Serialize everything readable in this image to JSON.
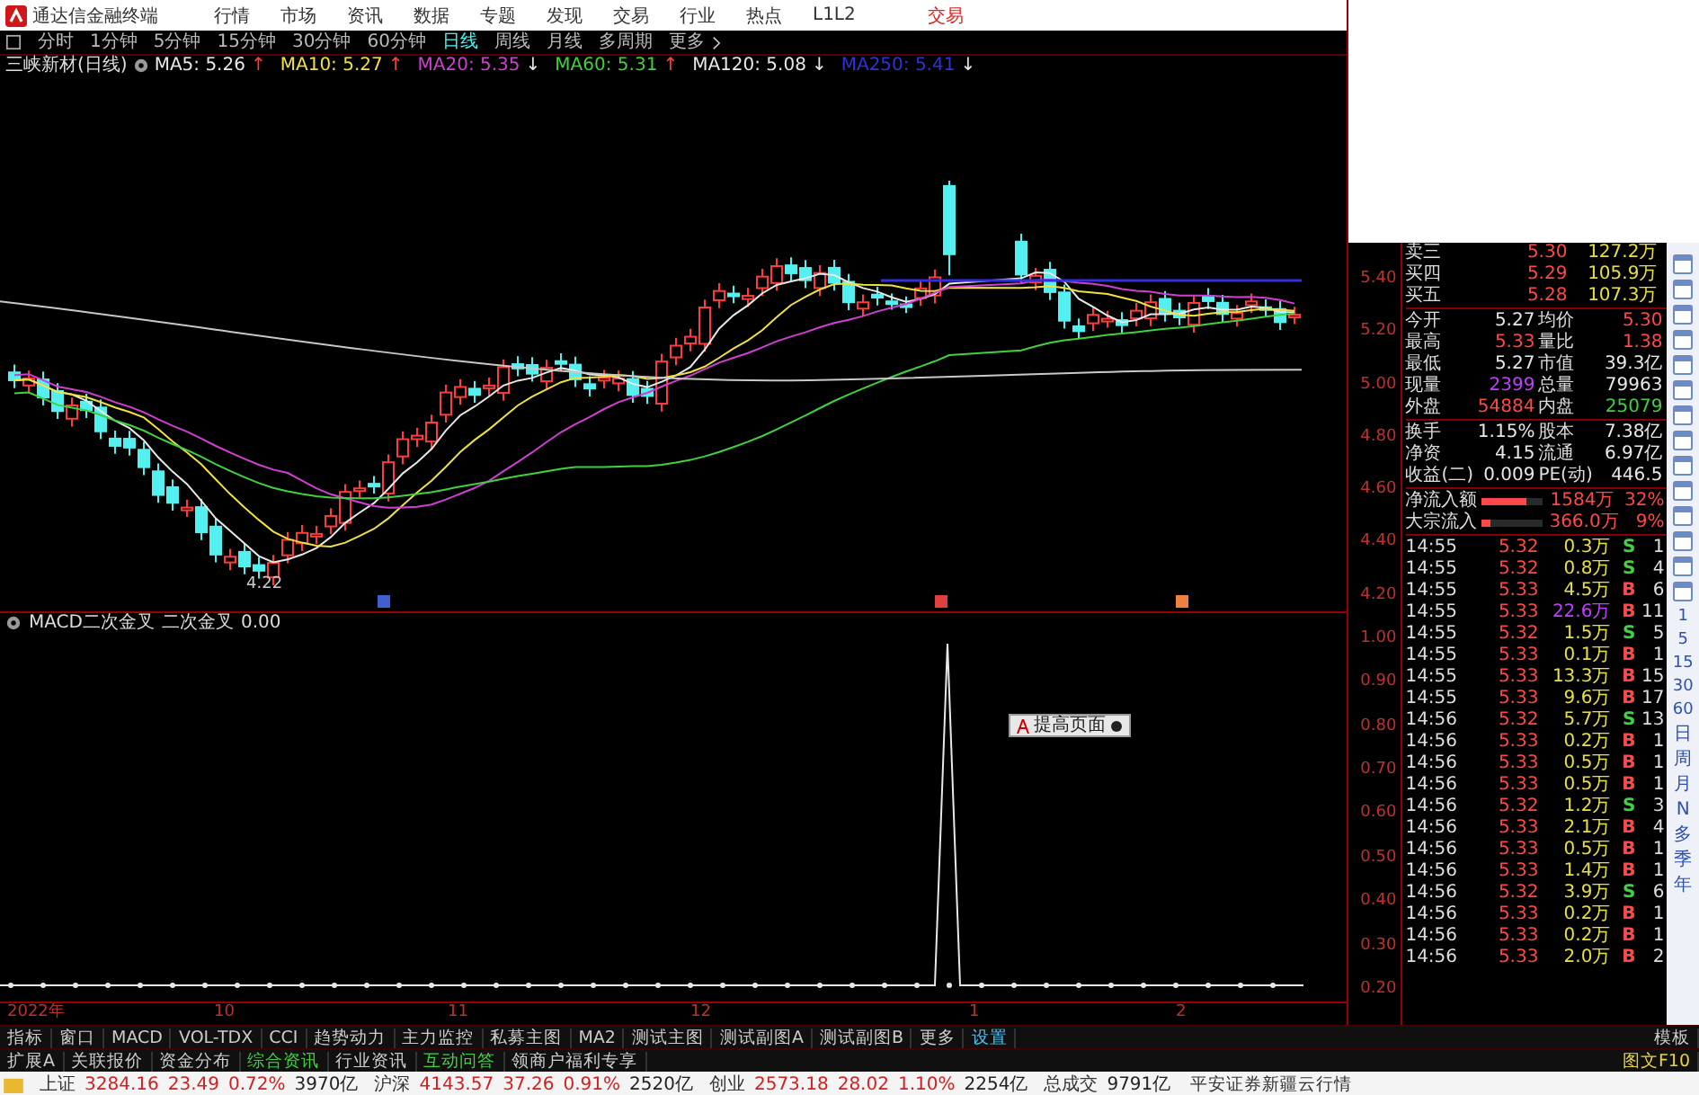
{
  "menu_bar": {
    "app_title": "通达信金融终端",
    "items": [
      "行情",
      "市场",
      "资讯",
      "数据",
      "专题",
      "发现",
      "交易",
      "行业",
      "热点",
      "L1L2"
    ],
    "trade_link": "交易"
  },
  "period_bar": {
    "items": [
      {
        "label": "分时",
        "selected": false
      },
      {
        "label": "1分钟",
        "selected": false
      },
      {
        "label": "5分钟",
        "selected": false
      },
      {
        "label": "15分钟",
        "selected": false
      },
      {
        "label": "30分钟",
        "selected": false
      },
      {
        "label": "60分钟",
        "selected": false
      },
      {
        "label": "日线",
        "selected": true
      },
      {
        "label": "周线",
        "selected": false
      },
      {
        "label": "月线",
        "selected": false
      },
      {
        "label": "多周期",
        "selected": false
      }
    ],
    "more": "更多"
  },
  "ma_legend": {
    "title": "三峡新材(日线)",
    "items": [
      {
        "label": "MA5: 5.26",
        "color": "#e8e8e8",
        "arrow": {
          "text": "↑",
          "color": "#ff4040"
        }
      },
      {
        "label": "MA10: 5.27",
        "color": "#f0e040",
        "arrow": {
          "text": "↑",
          "color": "#ff4040"
        }
      },
      {
        "label": "MA20: 5.35",
        "color": "#d040d0",
        "arrow": {
          "text": "↓",
          "color": "#e8e8e8"
        }
      },
      {
        "label": "MA60: 5.31",
        "color": "#40d040",
        "arrow": {
          "text": "↑",
          "color": "#ff4040"
        }
      },
      {
        "label": "MA120: 5.08",
        "color": "#e8e8e8",
        "arrow": {
          "text": "↓",
          "color": "#e8e8e8"
        }
      },
      {
        "label": "MA250: 5.41",
        "color": "#3030e0",
        "arrow": {
          "text": "↓",
          "color": "#e8e8e8"
        }
      }
    ]
  },
  "price_chart": {
    "low_label": "4.22",
    "axis_labels": [
      "5.40",
      "5.20",
      "5.00",
      "4.80",
      "4.60",
      "4.40",
      "4.20"
    ]
  },
  "indicator": {
    "name": "MACD二次金叉",
    "line": "二次金叉",
    "value": "0.00",
    "popup": "提高页面",
    "axis_labels": [
      "1.00",
      "0.90",
      "0.80",
      "0.70",
      "0.60",
      "0.50",
      "0.40",
      "0.30",
      "0.20"
    ]
  },
  "date_axis": [
    "2022年",
    "10",
    "11",
    "12",
    "1",
    "2"
  ],
  "indicator_tabs": [
    {
      "label": "指标",
      "highlighted": false
    },
    {
      "label": "窗口",
      "highlighted": false
    },
    {
      "label": "MACD",
      "highlighted": false
    },
    {
      "label": "VOL-TDX",
      "highlighted": false
    },
    {
      "label": "CCI",
      "highlighted": false
    },
    {
      "label": "趋势动力",
      "highlighted": false
    },
    {
      "label": "主力监控",
      "highlighted": false
    },
    {
      "label": "私募主图",
      "highlighted": false
    },
    {
      "label": "MA2",
      "highlighted": false
    },
    {
      "label": "测试主图",
      "highlighted": false
    },
    {
      "label": "测试副图A",
      "highlighted": false
    },
    {
      "label": "测试副图B",
      "highlighted": false
    },
    {
      "label": "更多",
      "highlighted": false
    },
    {
      "label": "设置",
      "highlighted": true
    }
  ],
  "template_button": "模板",
  "info_tabs": [
    {
      "label": "扩展A",
      "highlighted": false
    },
    {
      "label": "关联报价",
      "highlighted": false
    },
    {
      "label": "资金分布",
      "highlighted": false
    },
    {
      "label": "综合资讯",
      "highlighted": true
    },
    {
      "label": "行业资讯",
      "highlighted": false
    },
    {
      "label": "互动问答",
      "highlighted": true
    },
    {
      "label": "领商户福利专享",
      "highlighted": false
    }
  ],
  "f10_button": "图文F10",
  "quote_panel": {
    "order_book": [
      {
        "label": "卖三",
        "price": "5.30",
        "volume": "127.2万"
      },
      {
        "label": "买四",
        "price": "5.29",
        "volume": "105.9万"
      },
      {
        "label": "买五",
        "price": "5.28",
        "volume": "107.3万"
      }
    ],
    "stat_groups": [
      [
        [
          {
            "label": "今开",
            "value": "5.27",
            "color": "#e8e8e8"
          },
          {
            "label": "均价",
            "value": "5.30",
            "color": "#ff4848"
          }
        ],
        [
          {
            "label": "最高",
            "value": "5.33",
            "color": "#ff4848"
          },
          {
            "label": "量比",
            "value": "1.38",
            "color": "#ff4848"
          }
        ],
        [
          {
            "label": "最低",
            "value": "5.27",
            "color": "#e8e8e8"
          },
          {
            "label": "市值",
            "value": "39.3亿",
            "color": "#e8e8e8"
          }
        ],
        [
          {
            "label": "现量",
            "value": "2399",
            "color": "#c040ff"
          },
          {
            "label": "总量",
            "value": "79963",
            "color": "#e8e8e8"
          }
        ],
        [
          {
            "label": "外盘",
            "value": "54884",
            "color": "#ff4848"
          },
          {
            "label": "内盘",
            "value": "25079",
            "color": "#40d040"
          }
        ]
      ],
      [
        [
          {
            "label": "换手",
            "value": "1.15%",
            "color": "#e8e8e8"
          },
          {
            "label": "股本",
            "value": "7.38亿",
            "color": "#e8e8e8"
          }
        ],
        [
          {
            "label": "净资",
            "value": "4.15",
            "color": "#e8e8e8"
          },
          {
            "label": "流通",
            "value": "6.97亿",
            "color": "#e8e8e8"
          }
        ],
        [
          {
            "label": "收益(二)",
            "value": "0.009",
            "color": "#e8e8e8"
          },
          {
            "label": "PE(动)",
            "value": "446.5",
            "color": "#e8e8e8"
          }
        ]
      ]
    ],
    "flows": [
      {
        "label": "净流入额",
        "level": 0.75,
        "amount": "1584万",
        "share": "32%"
      },
      {
        "label": "大宗流入",
        "level": 0.15,
        "amount": "366.0万",
        "share": "9%"
      }
    ],
    "trades": [
      {
        "time": "14:55",
        "price": "5.32",
        "volume": "0.3万",
        "side": "S",
        "kind": "sell",
        "large": false,
        "count": "1"
      },
      {
        "time": "14:55",
        "price": "5.32",
        "volume": "0.8万",
        "side": "S",
        "kind": "sell",
        "large": false,
        "count": "4"
      },
      {
        "time": "14:55",
        "price": "5.33",
        "volume": "4.5万",
        "side": "B",
        "kind": "buy",
        "large": false,
        "count": "6"
      },
      {
        "time": "14:55",
        "price": "5.33",
        "volume": "22.6万",
        "side": "B",
        "kind": "buy",
        "large": true,
        "count": "11"
      },
      {
        "time": "14:55",
        "price": "5.32",
        "volume": "1.5万",
        "side": "S",
        "kind": "sell",
        "large": false,
        "count": "5"
      },
      {
        "time": "14:55",
        "price": "5.33",
        "volume": "0.1万",
        "side": "B",
        "kind": "buy",
        "large": false,
        "count": "1"
      },
      {
        "time": "14:55",
        "price": "5.33",
        "volume": "13.3万",
        "side": "B",
        "kind": "buy",
        "large": false,
        "count": "15"
      },
      {
        "time": "14:55",
        "price": "5.33",
        "volume": "9.6万",
        "side": "B",
        "kind": "buy",
        "large": false,
        "count": "17"
      },
      {
        "time": "14:56",
        "price": "5.32",
        "volume": "5.7万",
        "side": "S",
        "kind": "sell",
        "large": false,
        "count": "13"
      },
      {
        "time": "14:56",
        "price": "5.33",
        "volume": "0.2万",
        "side": "B",
        "kind": "buy",
        "large": false,
        "count": "1"
      },
      {
        "time": "14:56",
        "price": "5.33",
        "volume": "0.5万",
        "side": "B",
        "kind": "buy",
        "large": false,
        "count": "1"
      },
      {
        "time": "14:56",
        "price": "5.33",
        "volume": "0.5万",
        "side": "B",
        "kind": "buy",
        "large": false,
        "count": "1"
      },
      {
        "time": "14:56",
        "price": "5.32",
        "volume": "1.2万",
        "side": "S",
        "kind": "sell",
        "large": false,
        "count": "3"
      },
      {
        "time": "14:56",
        "price": "5.33",
        "volume": "2.1万",
        "side": "B",
        "kind": "buy",
        "large": false,
        "count": "4"
      },
      {
        "time": "14:56",
        "price": "5.33",
        "volume": "0.5万",
        "side": "B",
        "kind": "buy",
        "large": false,
        "count": "1"
      },
      {
        "time": "14:56",
        "price": "5.33",
        "volume": "1.4万",
        "side": "B",
        "kind": "buy",
        "large": false,
        "count": "1"
      },
      {
        "time": "14:56",
        "price": "5.32",
        "volume": "3.9万",
        "side": "S",
        "kind": "sell",
        "large": false,
        "count": "6"
      },
      {
        "time": "14:56",
        "price": "5.33",
        "volume": "0.2万",
        "side": "B",
        "kind": "buy",
        "large": false,
        "count": "1"
      },
      {
        "time": "14:56",
        "price": "5.33",
        "volume": "0.2万",
        "side": "B",
        "kind": "buy",
        "large": false,
        "count": "1"
      },
      {
        "time": "14:56",
        "price": "5.33",
        "volume": "2.0万",
        "side": "B",
        "kind": "buy",
        "large": false,
        "count": "2"
      }
    ]
  },
  "side_toolbar": {
    "periods": [
      "1",
      "5",
      "15",
      "30",
      "60"
    ],
    "cycles": [
      "日",
      "周",
      "月",
      "N",
      "多",
      "季",
      "年"
    ]
  },
  "status_bar": {
    "indices": [
      {
        "name": "上证",
        "value": "3284.16",
        "change": "23.49",
        "percent": "0.72%",
        "turnover": "3970亿"
      },
      {
        "name": "沪深",
        "value": "4143.57",
        "change": "37.26",
        "percent": "0.91%",
        "turnover": "2520亿"
      },
      {
        "name": "创业",
        "value": "2573.18",
        "change": "28.02",
        "percent": "1.10%",
        "turnover": "2254亿"
      }
    ],
    "total_label": "总成交",
    "total_value": "9791亿",
    "broker": "平安证券新疆云行情"
  }
}
